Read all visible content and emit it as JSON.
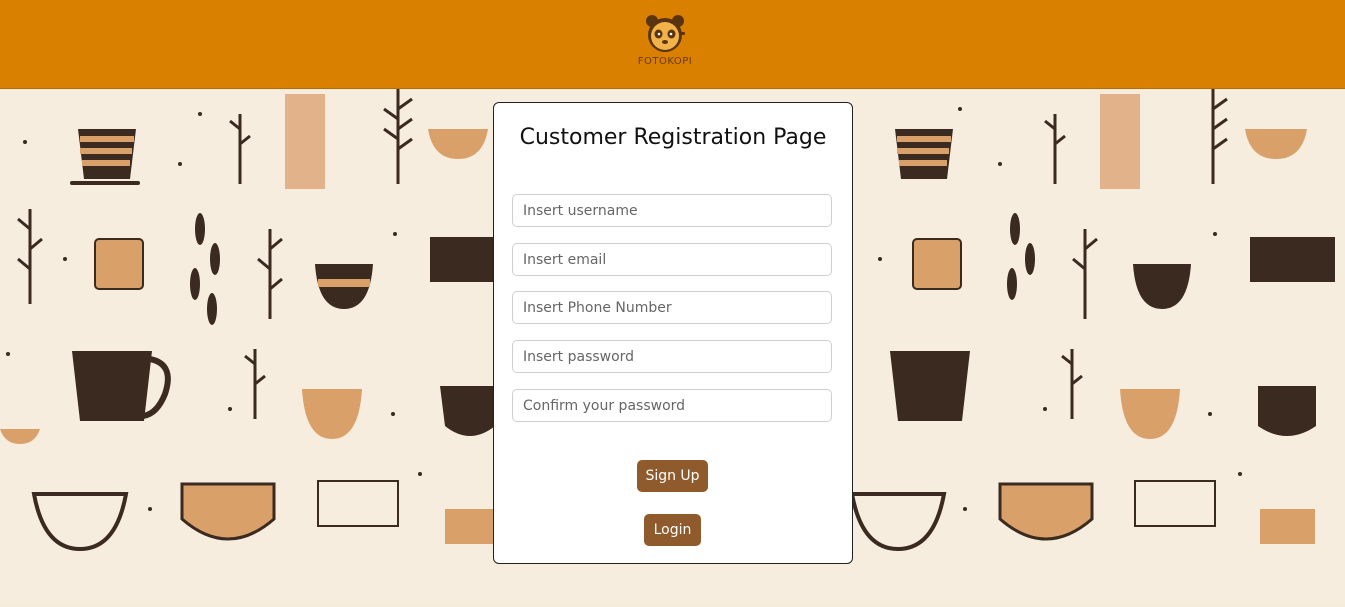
{
  "header": {
    "logo_text": "FOTOKOPI",
    "logo_icon": "panda-icon",
    "color": "#d98000"
  },
  "form": {
    "title": "Customer Registration Page",
    "fields": [
      {
        "placeholder": "Insert username"
      },
      {
        "placeholder": "Insert email"
      },
      {
        "placeholder": "Insert Phone Number"
      },
      {
        "placeholder": "Insert password"
      },
      {
        "placeholder": "Confirm your password"
      }
    ],
    "signup_label": "Sign Up",
    "login_label": "Login",
    "button_color": "#8f5a2c"
  },
  "background": {
    "pattern": "coffee-cups-and-leaves",
    "color": "#f7eddf"
  }
}
